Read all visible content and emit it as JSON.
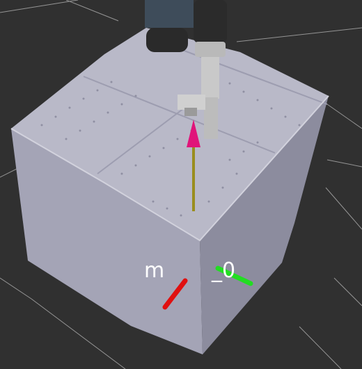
{
  "scene": {
    "background_color": "#303030",
    "grid_color": "#a0a0a0",
    "table_top_color": "#b9b9c8",
    "table_side_left_color": "#a4a4b6",
    "table_side_right_color": "#8c8c9e",
    "robot_color": "#2b2b2b",
    "gripper_color": "#c9c9c9",
    "marker_cone_color": "#e0157a",
    "marker_shaft_color": "#9a8e1e"
  },
  "axes_labels": {
    "left_label": "m",
    "right_label": "_0"
  },
  "axis_colors": {
    "x_axis": "#e01010",
    "y_axis": "#22dd22"
  }
}
